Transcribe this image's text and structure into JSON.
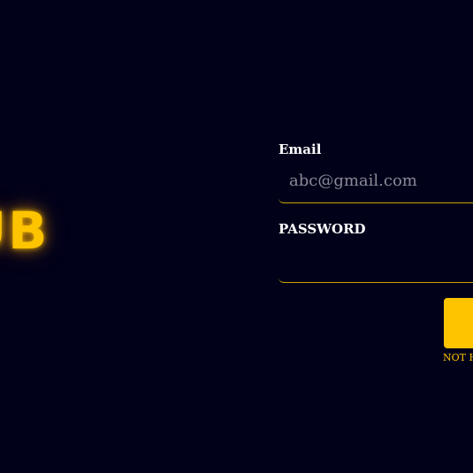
{
  "brand": {
    "text": "UB"
  },
  "form": {
    "email_label": "Email",
    "email_placeholder": "abc@gmail.com",
    "email_value": "",
    "password_label": "PASSWORD",
    "password_value": ""
  },
  "actions": {
    "signup_link": "NOT H"
  },
  "colors": {
    "background": "#01011a",
    "accent": "#ffc400",
    "text": "#ffffff"
  }
}
